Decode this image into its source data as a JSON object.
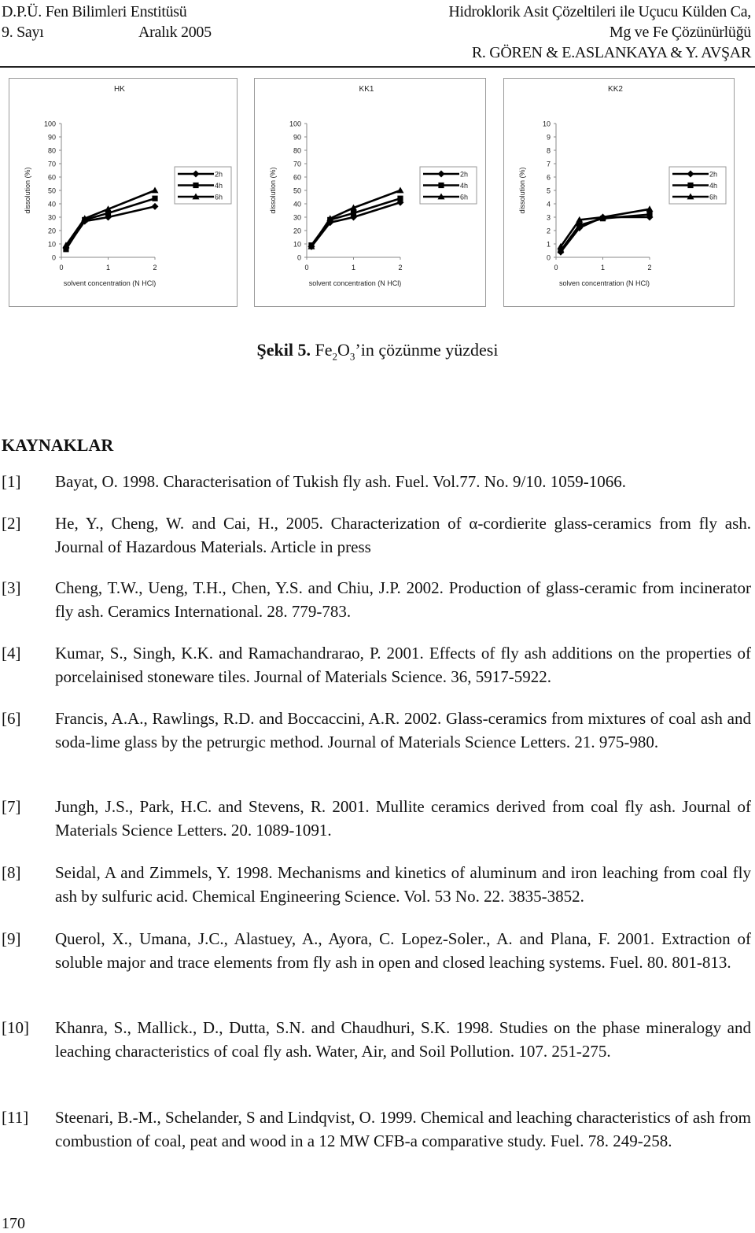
{
  "header": {
    "left_line1": "D.P.Ü. Fen Bilimleri Enstitüsü",
    "left_line2_issue": "9. Sayı",
    "left_line2_date": "Aralık 2005",
    "right_line1": "Hidroklorik Asit Çözeltileri ile Uçucu Külden Ca,",
    "right_line2": "Mg ve Fe Çözünürlüğü",
    "right_line3": "R. GÖREN & E.ASLANKAYA & Y. AVŞAR"
  },
  "figure": {
    "caption_label": "Şekil 5.",
    "caption_pre": " Fe",
    "caption_sub1": "2",
    "caption_mid": "O",
    "caption_sub2": "3",
    "caption_post": "’in çözünme yüzdesi"
  },
  "chart_data": [
    {
      "type": "line",
      "title": "HK",
      "xlabel": "solvent concentration (N HCl)",
      "ylabel": "dissolution (%)",
      "xlim": [
        0,
        2
      ],
      "ylim": [
        0,
        100
      ],
      "xticks": [
        0,
        1,
        2
      ],
      "yticks": [
        0,
        10,
        20,
        30,
        40,
        50,
        60,
        70,
        80,
        90,
        100
      ],
      "grid": false,
      "legend": "right",
      "x": [
        0.1,
        0.5,
        1,
        2
      ],
      "series": [
        {
          "name": "2h",
          "marker": "diamond",
          "values": [
            7,
            27,
            30,
            38
          ]
        },
        {
          "name": "4h",
          "marker": "square",
          "values": [
            6,
            28,
            33,
            44
          ]
        },
        {
          "name": "6h",
          "marker": "triangle",
          "values": [
            9,
            29,
            36,
            50
          ]
        }
      ]
    },
    {
      "type": "line",
      "title": "KK1",
      "xlabel": "solvent concentration (N HCl)",
      "ylabel": "dissolution (%)",
      "xlim": [
        0,
        2
      ],
      "ylim": [
        0,
        100
      ],
      "xticks": [
        0,
        1,
        2
      ],
      "yticks": [
        0,
        10,
        20,
        30,
        40,
        50,
        60,
        70,
        80,
        90,
        100
      ],
      "grid": false,
      "legend": "right",
      "x": [
        0.1,
        0.5,
        1,
        2
      ],
      "series": [
        {
          "name": "2h",
          "marker": "diamond",
          "values": [
            8,
            26,
            30,
            41
          ]
        },
        {
          "name": "4h",
          "marker": "square",
          "values": [
            9,
            28,
            33,
            44
          ]
        },
        {
          "name": "6h",
          "marker": "triangle",
          "values": [
            8,
            29,
            37,
            50
          ]
        }
      ]
    },
    {
      "type": "line",
      "title": "KK2",
      "xlabel": "solven concentration (N HCl)",
      "ylabel": "dissolution (%)",
      "xlim": [
        0,
        2
      ],
      "ylim": [
        0,
        10
      ],
      "xticks": [
        0,
        1,
        2
      ],
      "yticks": [
        0,
        1,
        2,
        3,
        4,
        5,
        6,
        7,
        8,
        9,
        10
      ],
      "grid": false,
      "legend": "right",
      "x": [
        0.1,
        0.5,
        1,
        2
      ],
      "series": [
        {
          "name": "2h",
          "marker": "diamond",
          "values": [
            0.4,
            2.2,
            3.0,
            3.0
          ]
        },
        {
          "name": "4h",
          "marker": "square",
          "values": [
            0.5,
            2.4,
            2.9,
            3.2
          ]
        },
        {
          "name": "6h",
          "marker": "triangle",
          "values": [
            0.8,
            2.8,
            3.0,
            3.6
          ]
        }
      ]
    }
  ],
  "references": {
    "heading": "KAYNAKLAR",
    "items": [
      {
        "num": "[1]",
        "text": "Bayat, O. 1998. Characterisation of Tukish fly ash. Fuel. Vol.77. No. 9/10. 1059-1066."
      },
      {
        "num": "[2]",
        "text": "He, Y., Cheng, W. and Cai, H., 2005. Characterization of α-cordierite glass-ceramics from fly ash. Journal of Hazardous Materials. Article in press"
      },
      {
        "num": "[3]",
        "text": "Cheng, T.W., Ueng, T.H., Chen, Y.S. and Chiu, J.P. 2002. Production of glass-ceramic from incinerator fly ash. Ceramics International.  28. 779-783."
      },
      {
        "num": "[4]",
        "text": "Kumar, S., Singh, K.K. and Ramachandrarao, P. 2001. Effects of fly ash additions on the properties of porcelainised stoneware tiles. Journal of Materials Science. 36, 5917-5922."
      },
      {
        "num": "[6]",
        "text": "Francis, A.A., Rawlings, R.D. and Boccaccini, A.R. 2002. Glass-ceramics from mixtures of coal ash and soda-lime glass by the petrurgic method. Journal of Materials Science Letters. 21. 975-980."
      },
      {
        "num": "[7]",
        "text": "Jungh, J.S., Park, H.C. and Stevens, R. 2001. Mullite ceramics derived from coal fly ash. Journal of Materials Science Letters. 20. 1089-1091."
      },
      {
        "num": "[8]",
        "text": "Seidal, A and Zimmels, Y. 1998. Mechanisms and kinetics of aluminum and iron leaching from coal fly ash by sulfuric acid. Chemical Engineering Science. Vol. 53 No. 22. 3835-3852."
      },
      {
        "num": "[9]",
        "text": "Querol, X., Umana, J.C., Alastuey, A., Ayora, C. Lopez-Soler., A. and Plana, F. 2001. Extraction of soluble major and trace elements from fly ash in open and closed leaching systems. Fuel. 80. 801-813."
      },
      {
        "num": "[10]",
        "text": "Khanra, S., Mallick., D., Dutta, S.N. and Chaudhuri, S.K. 1998. Studies on the phase mineralogy and leaching characteristics of coal fly ash. Water, Air, and Soil Pollution. 107. 251-275."
      },
      {
        "num": "[11]",
        "text": "Steenari, B.-M., Schelander, S and Lindqvist, O. 1999. Chemical and leaching characteristics of ash from combustion of coal, peat and wood in a 12 MW CFB-a comparative study. Fuel. 78. 249-258."
      }
    ]
  },
  "page_number": "170"
}
